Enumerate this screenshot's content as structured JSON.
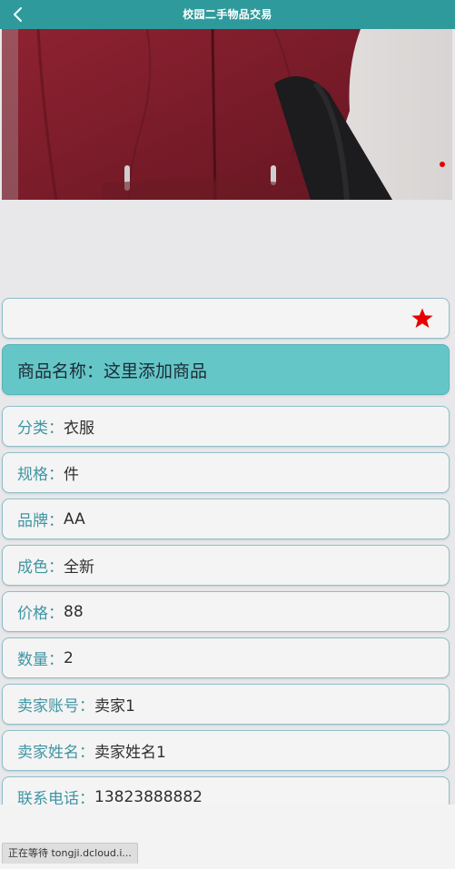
{
  "header": {
    "title": "校园二手物品交易",
    "back_icon": "back-chevron-icon"
  },
  "banner": {
    "indicator_color": "#e00000"
  },
  "favorite": {
    "icon": "star-icon",
    "color": "#e60000"
  },
  "product": {
    "name_label": "商品名称：",
    "name_value": "这里添加商品"
  },
  "fields": [
    {
      "label": "分类：",
      "value": "衣服"
    },
    {
      "label": "规格：",
      "value": "件"
    },
    {
      "label": "品牌：",
      "value": "AA"
    },
    {
      "label": "成色：",
      "value": "全新"
    },
    {
      "label": "价格：",
      "value": "88"
    },
    {
      "label": "数量：",
      "value": "2"
    },
    {
      "label": "卖家账号：",
      "value": "卖家1"
    },
    {
      "label": "卖家姓名：",
      "value": "卖家姓名1"
    },
    {
      "label": "联系电话：",
      "value": "13823888882"
    }
  ],
  "status_bar": {
    "text": "正在等待 tongji.dcloud.i..."
  },
  "colors": {
    "header": "#2f9a9c",
    "name_card": "#65c6c8",
    "label": "#3f95a3"
  }
}
